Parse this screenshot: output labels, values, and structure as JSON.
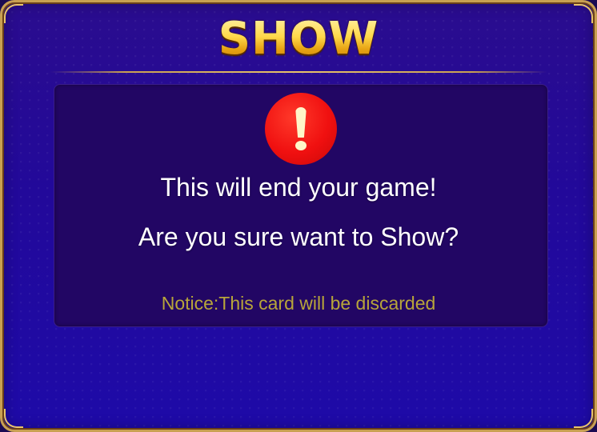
{
  "dialog": {
    "title": "SHOW",
    "alert_icon": "exclamation-icon",
    "message_line1": "This will end your game!",
    "message_line2": "Are you sure want to Show?",
    "notice": "Notice:This card will be discarded"
  },
  "colors": {
    "background": "#22099a",
    "border_gold": "#c9a052",
    "title_gold": "#ffd84a",
    "alert_red": "#f01010",
    "notice_text": "#b8a53a",
    "panel": "#220664"
  }
}
